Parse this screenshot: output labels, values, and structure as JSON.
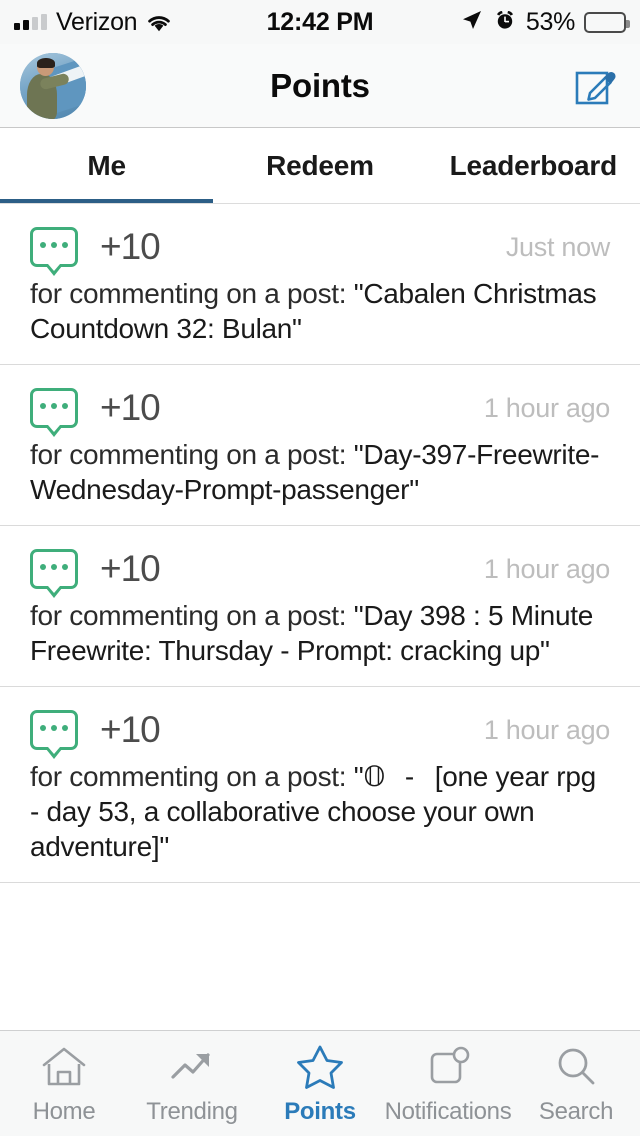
{
  "colors": {
    "accent_blue": "#2b7bb9",
    "tab_underline": "#2c5e86",
    "bubble_green": "#3fae7b",
    "points_gray": "#4c4c4c",
    "time_gray": "#bdbdbd",
    "nav_inactive": "#8e9296"
  },
  "status_bar": {
    "carrier": "Verizon",
    "signal_icon": "signal-bars-icon",
    "wifi_icon": "wifi-icon",
    "time": "12:42 PM",
    "location_icon": "location-arrow-icon",
    "alarm_icon": "alarm-clock-icon",
    "battery_percent": "53%",
    "battery_level": 53,
    "battery_icon": "battery-icon"
  },
  "header": {
    "avatar_name": "user-avatar",
    "title": "Points",
    "compose_icon": "compose-pencil-icon"
  },
  "tabs": {
    "items": [
      {
        "label": "Me",
        "active": true
      },
      {
        "label": "Redeem",
        "active": false
      },
      {
        "label": "Leaderboard",
        "active": false
      }
    ]
  },
  "entries": [
    {
      "icon": "comment-bubble-icon",
      "points": "+10",
      "time": "Just now",
      "reason_prefix": "for commenting on a post: ",
      "reason_title": "\"Cabalen Christmas Countdown 32: Bulan\""
    },
    {
      "icon": "comment-bubble-icon",
      "points": "+10",
      "time": "1 hour ago",
      "reason_prefix": "for commenting on a post: ",
      "reason_title": "\"Day-397-Freewrite-Wednesday-Prompt-passenger\""
    },
    {
      "icon": "comment-bubble-icon",
      "points": "+10",
      "time": "1 hour ago",
      "reason_prefix": "for commenting on a post: ",
      "reason_title": "\"Day 398 : 5 Minute Freewrite: Thursday - Prompt: cracking up\""
    },
    {
      "icon": "comment-bubble-icon",
      "points": "+10",
      "time": "1 hour ago",
      "reason_prefix": "for commenting on a post: ",
      "reason_title": "\"𝕆𝕅𝔼 𝕐𝔼𝔸ℝ ℝℙ𝔾 - 𝔻𝔸𝕐 𝟝𝟛 [one year rpg - day 53, a collaborative choose your own adventure]\""
    }
  ],
  "bottom_nav": {
    "items": [
      {
        "label": "Home",
        "icon": "home-icon",
        "active": false
      },
      {
        "label": "Trending",
        "icon": "trending-arrow-icon",
        "active": false
      },
      {
        "label": "Points",
        "icon": "star-icon",
        "active": true
      },
      {
        "label": "Notifications",
        "icon": "notifications-badge-icon",
        "active": false
      },
      {
        "label": "Search",
        "icon": "search-magnifier-icon",
        "active": false
      }
    ]
  }
}
